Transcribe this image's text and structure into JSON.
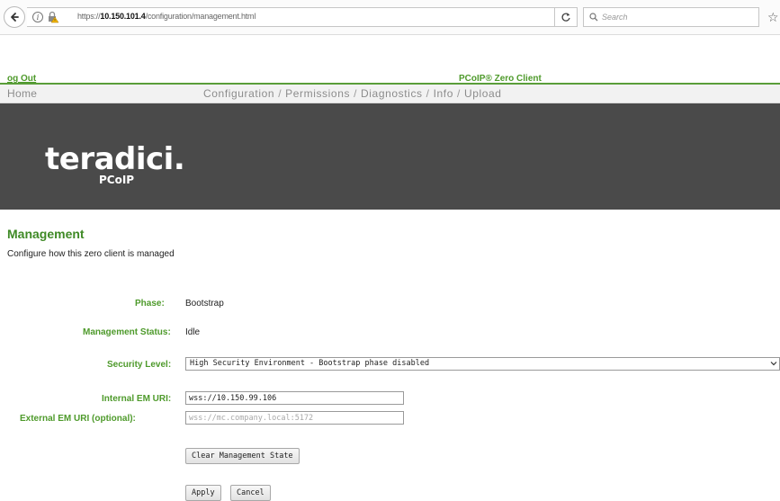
{
  "browser": {
    "url_prefix": "https://",
    "url_host": "10.150.101.4",
    "url_path": "/configuration/management.html",
    "search_placeholder": "Search"
  },
  "header": {
    "logout_label": "og Out",
    "product_name": "PCoIP® Zero Client"
  },
  "nav": {
    "home": "Home",
    "items": [
      {
        "label": "Configuration"
      },
      {
        "label": "Permissions"
      },
      {
        "label": "Diagnostics"
      },
      {
        "label": "Info"
      },
      {
        "label": "Upload"
      }
    ],
    "separator": "/"
  },
  "banner": {
    "logo_text": "teradici.",
    "logo_sub": "PCoIP"
  },
  "page": {
    "title": "Management",
    "description": "Configure how this zero client is managed"
  },
  "form": {
    "phase_label": "Phase:",
    "phase_value": "Bootstrap",
    "status_label": "Management Status:",
    "status_value": "Idle",
    "security_label": "Security Level:",
    "security_value": "High Security Environment - Bootstrap phase disabled",
    "internal_label": "Internal EM URI:",
    "internal_value": "wss://10.150.99.106",
    "external_label": "External EM URI (optional):",
    "external_placeholder": "wss://mc.company.local:5172",
    "clear_button": "Clear Management State",
    "apply_button": "Apply",
    "cancel_button": "Cancel"
  },
  "colors": {
    "label_green": "#4e9a2b",
    "banner_bg": "#4a4a4a"
  }
}
